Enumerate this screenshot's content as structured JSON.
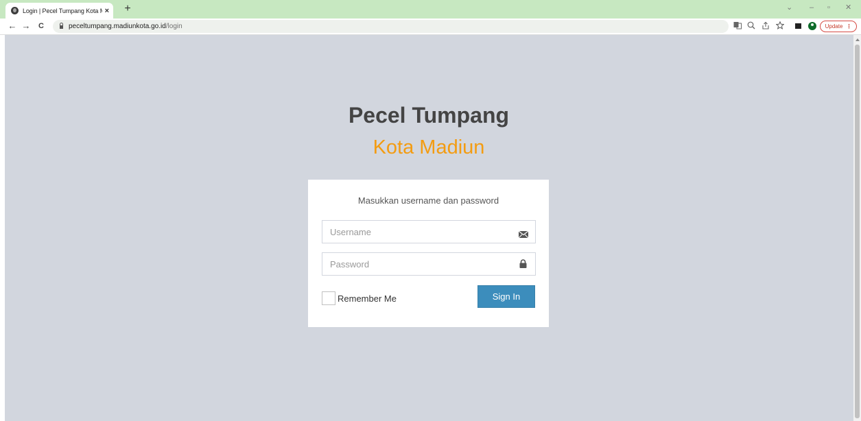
{
  "browser": {
    "tab_title": "Login | Pecel Tumpang Kota Madiun",
    "tab_close": "×",
    "new_tab": "+",
    "url_host": "peceltumpang.madiunkota.go.id",
    "url_path": "/login",
    "update_label": "Update",
    "update_menu": "⋮",
    "back": "←",
    "forward": "→",
    "reload": "C",
    "win_chevron": "⌄",
    "win_minimize": "–",
    "win_restore": "▫",
    "win_close": "✕",
    "icons": [
      "translate-icon",
      "zoom-icon",
      "share-icon",
      "bookmark-star-icon",
      "side-panel-icon",
      "profile-icon"
    ]
  },
  "login": {
    "title": "Pecel Tumpang",
    "subtitle": "Kota Madiun",
    "message": "Masukkan username dan password",
    "username_placeholder": "Username",
    "password_placeholder": "Password",
    "remember_label": "Remember Me",
    "signin_label": "Sign In"
  },
  "colors": {
    "page_bg": "#d2d6de",
    "title": "#444444",
    "subtitle": "#f39c12",
    "primary_button": "#3c8dbc",
    "tab_strip": "#c7e8c1"
  }
}
